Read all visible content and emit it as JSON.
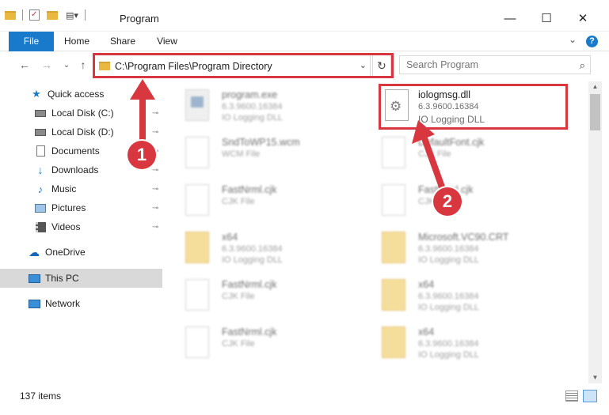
{
  "window": {
    "title": "Program",
    "minimize_glyph": "—",
    "maximize_glyph": "☐",
    "close_glyph": "✕"
  },
  "ribbon": {
    "tabs": [
      {
        "label": "File"
      },
      {
        "label": "Home"
      },
      {
        "label": "Share"
      },
      {
        "label": "View"
      }
    ],
    "help_glyph": "?",
    "expand_glyph": "⌄"
  },
  "navigation": {
    "back_glyph": "←",
    "forward_glyph": "→",
    "recent_glyph": "⌄",
    "up_glyph": "↑",
    "address": "C:\\Program Files\\Program Directory",
    "address_chevron": "⌄",
    "refresh_glyph": "↻",
    "search_placeholder": "Search Program",
    "search_icon": "⌕"
  },
  "sidebar": {
    "items": [
      {
        "label": "Quick access",
        "icon": "star-icon",
        "pinned": false
      },
      {
        "label": "Local Disk (C:)",
        "icon": "drive-icon",
        "pinned": true
      },
      {
        "label": "Local Disk (D:)",
        "icon": "drive-icon",
        "pinned": true
      },
      {
        "label": "Documents",
        "icon": "documents-icon",
        "pinned": true
      },
      {
        "label": "Downloads",
        "icon": "download-icon",
        "pinned": true
      },
      {
        "label": "Music",
        "icon": "music-icon",
        "pinned": true
      },
      {
        "label": "Pictures",
        "icon": "pictures-icon",
        "pinned": true
      },
      {
        "label": "Videos",
        "icon": "videos-icon",
        "pinned": true
      },
      {
        "label": "OneDrive",
        "icon": "cloud-icon",
        "pinned": false
      },
      {
        "label": "This PC",
        "icon": "computer-icon",
        "pinned": false
      },
      {
        "label": "Network",
        "icon": "network-icon",
        "pinned": false
      }
    ],
    "pin_glyph": "📌"
  },
  "files": [
    {
      "name": "program.exe",
      "line1": "6.3.9600.16384",
      "line2": "IO Logging DLL",
      "icon": "exe-icon"
    },
    {
      "name": "iologmsg.dll",
      "line1": "6.3.9600.16384",
      "line2": "IO Logging DLL",
      "icon": "dll-gear-icon"
    },
    {
      "name": "SndToWP15.wcm",
      "line1": "WCM File",
      "line2": "",
      "icon": "blank-file-icon"
    },
    {
      "name": "DefaultFont.cjk",
      "line1": "CJK File",
      "line2": "",
      "icon": "blank-file-icon"
    },
    {
      "name": "FastNrml.cjk",
      "line1": "CJK File",
      "line2": "",
      "icon": "blank-file-icon"
    },
    {
      "name": "FastNrml.cjk",
      "line1": "CJK File",
      "line2": "",
      "icon": "blank-file-icon"
    },
    {
      "name": "x64",
      "line1": "6.3.9600.16384",
      "line2": "IO Logging DLL",
      "icon": "folder-icon"
    },
    {
      "name": "Microsoft.VC90.CRT",
      "line1": "6.3.9600.16384",
      "line2": "IO Logging DLL",
      "icon": "folder-icon"
    },
    {
      "name": "FastNrml.cjk",
      "line1": "CJK File",
      "line2": "",
      "icon": "blank-file-icon"
    },
    {
      "name": "x64",
      "line1": "6.3.9600.16384",
      "line2": "IO Logging DLL",
      "icon": "folder-icon"
    },
    {
      "name": "FastNrml.cjk",
      "line1": "CJK File",
      "line2": "",
      "icon": "blank-file-icon"
    },
    {
      "name": "x64",
      "line1": "6.3.9600.16384",
      "line2": "IO Logging DLL",
      "icon": "folder-icon"
    }
  ],
  "status": {
    "item_count": "137 items"
  },
  "callouts": [
    {
      "number": "1"
    },
    {
      "number": "2"
    }
  ],
  "colors": {
    "accent": "#1979ca",
    "highlight_red": "#d9373f",
    "selected_nav": "#d9d9d9"
  }
}
